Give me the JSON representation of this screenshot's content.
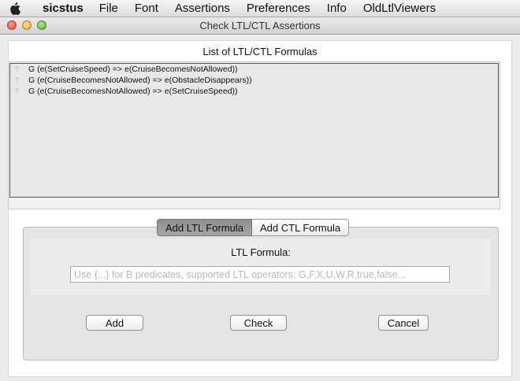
{
  "menubar": {
    "app_name": "sicstus",
    "items": [
      "File",
      "Font",
      "Assertions",
      "Preferences",
      "Info",
      "OldLtlViewers"
    ]
  },
  "window": {
    "title": "Check LTL/CTL Assertions"
  },
  "formulas": {
    "title": "List of LTL/CTL Formulas",
    "status_icon": "?",
    "rows": [
      "G (e(SetCruiseSpeed) => e(CruiseBecomesNotAllowed))",
      "G (e(CruiseBecomesNotAllowed) => e(ObstacleDisappears))",
      "G (e(CruiseBecomesNotAllowed) => e(SetCruiseSpeed))"
    ]
  },
  "tabs": {
    "add_ltl": "Add LTL Formula",
    "add_ctl": "Add CTL Formula",
    "active": "add_ltl"
  },
  "form": {
    "label": "LTL Formula:",
    "value": "",
    "placeholder": "Use {...} for B predicates, supported LTL operators: G,F,X,U,W,R,true,false..."
  },
  "buttons": {
    "add": "Add",
    "check": "Check",
    "cancel": "Cancel"
  }
}
